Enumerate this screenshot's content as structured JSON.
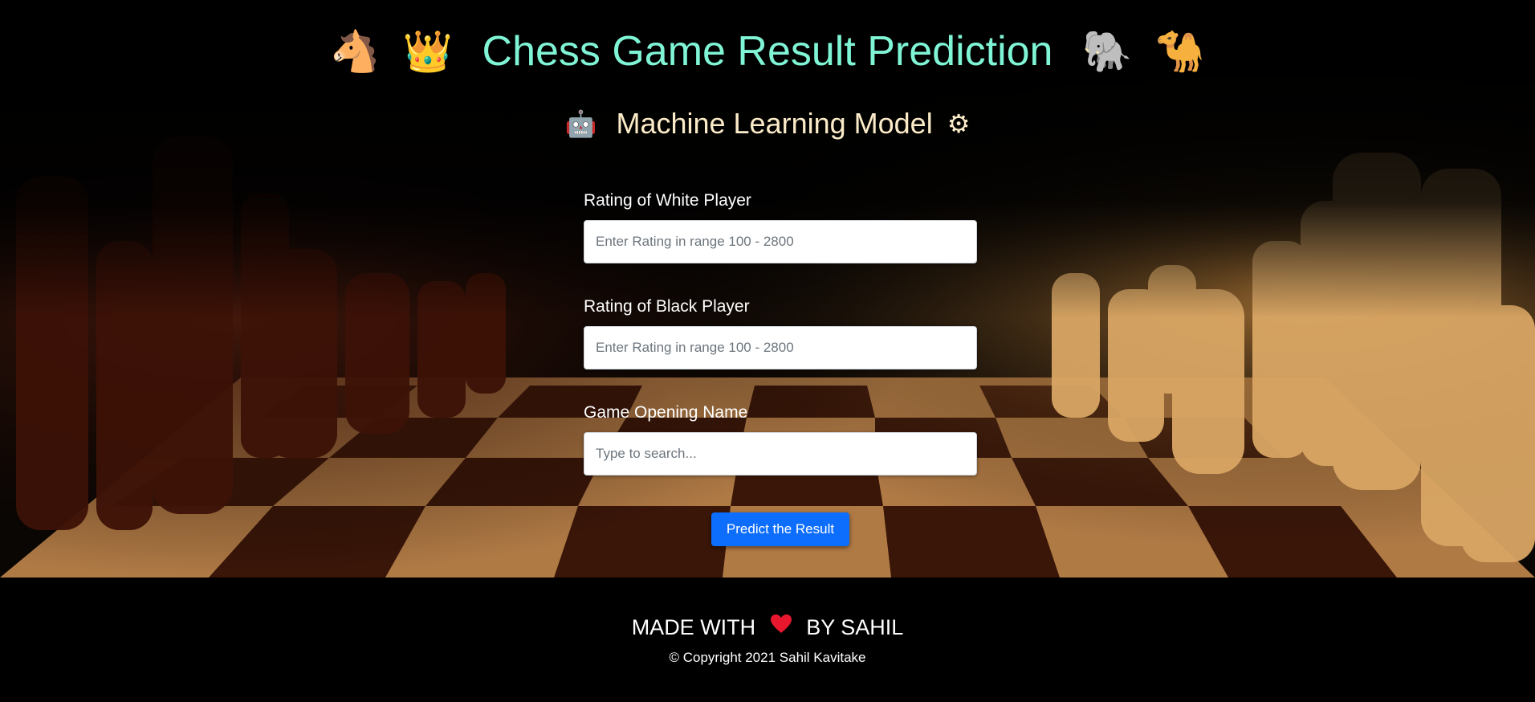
{
  "header": {
    "title": "Chess Game Result Prediction",
    "title_left_icons": [
      "horse-icon",
      "crown-icon"
    ],
    "title_right_icons": [
      "elephant-icon",
      "camel-icon"
    ],
    "subtitle": "Machine Learning Model",
    "subtitle_left_icon": "robot-icon",
    "subtitle_right_icon": "gear-icon"
  },
  "form": {
    "white_rating": {
      "label": "Rating of White Player",
      "placeholder": "Enter Rating in range 100 - 2800",
      "value": ""
    },
    "black_rating": {
      "label": "Rating of Black Player",
      "placeholder": "Enter Rating in range 100 - 2800",
      "value": ""
    },
    "opening": {
      "label": "Game Opening Name",
      "placeholder": "Type to search...",
      "value": ""
    },
    "submit_label": "Predict the Result"
  },
  "footer": {
    "made_with_prefix": "MADE WITH",
    "made_with_icon": "heart-icon",
    "made_with_suffix": "BY SAHIL",
    "copyright": "© Copyright 2021 Sahil Kavitake"
  },
  "colors": {
    "title": "#7ff5d5",
    "subtitle": "#fcebc8",
    "button": "#0d6efd",
    "footer_bg": "#000000"
  }
}
